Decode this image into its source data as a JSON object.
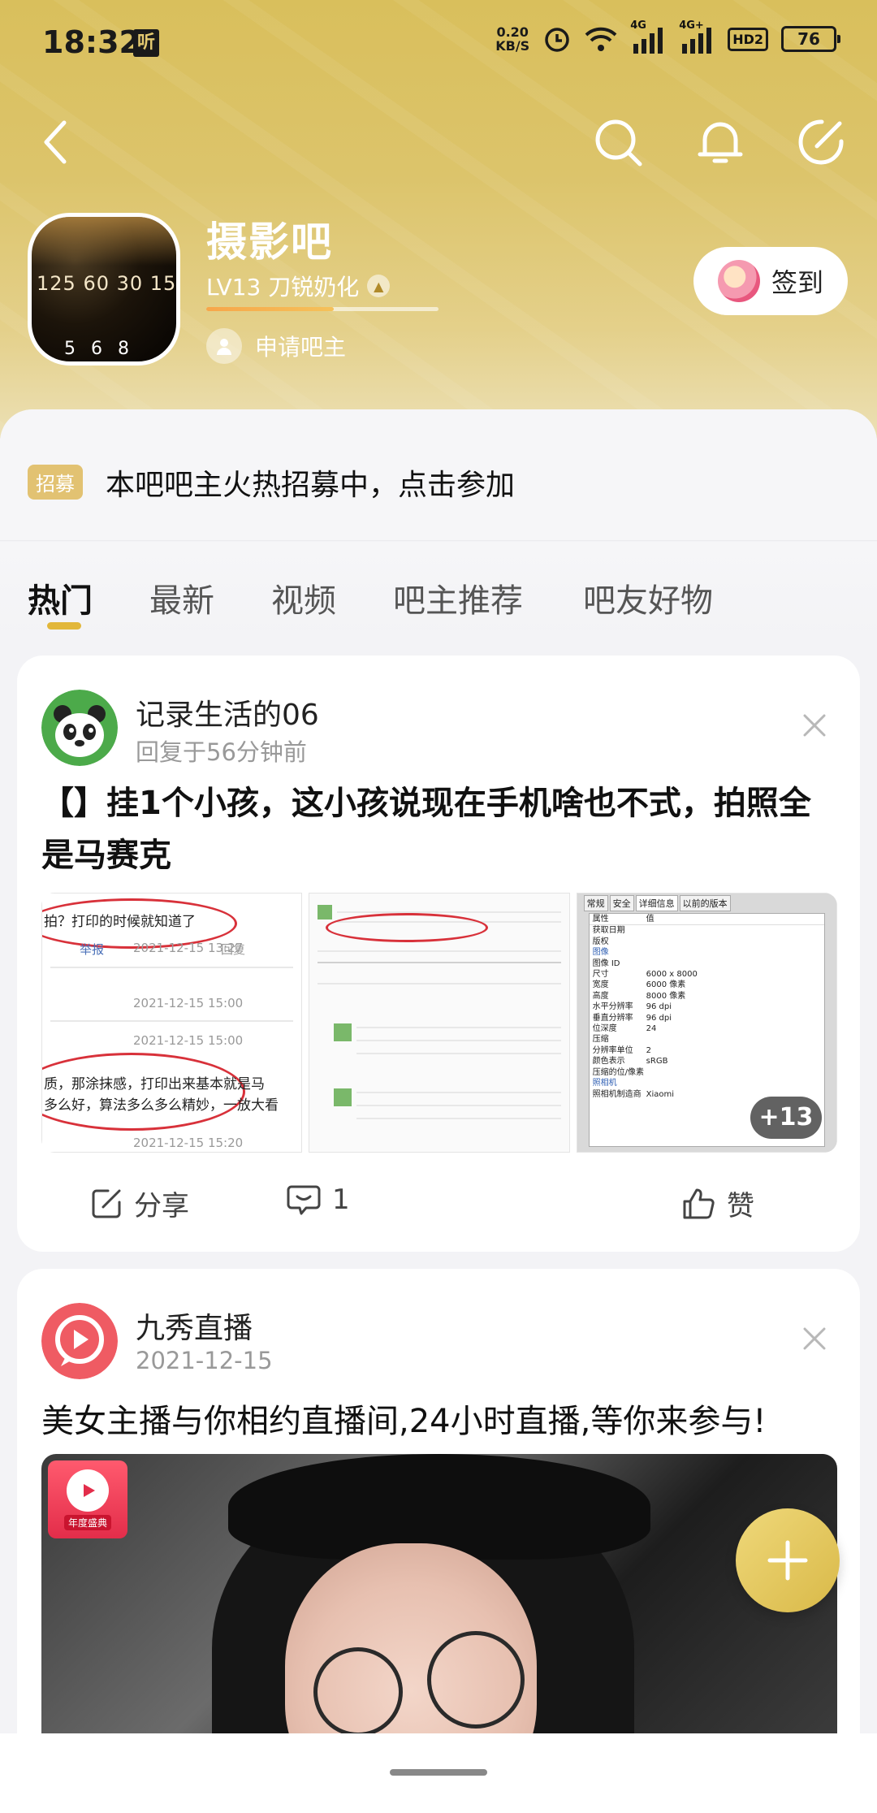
{
  "status_bar": {
    "time": "18:32",
    "notif_badge": "听",
    "net_speed_value": "0.20",
    "net_speed_unit": "KB/S",
    "signal1": "4G",
    "signal2": "4G+",
    "hd": "HD2",
    "battery": "76"
  },
  "forum": {
    "name": "摄影吧",
    "level": "LV13 刀锐奶化",
    "level_progress": 0.55,
    "apply_label": "申请吧主",
    "sign_label": "签到",
    "avatar_lens_text": "125 60 30 15",
    "avatar_lens_bottom": "5 6 8"
  },
  "notice": {
    "tag": "招募",
    "text": "本吧吧主火热招募中，点击参加"
  },
  "tabs": [
    "热门",
    "最新",
    "视频",
    "吧主推荐",
    "吧友好物"
  ],
  "posts": [
    {
      "author": "记录生活的06",
      "time": "回复于56分钟前",
      "title": "【】挂1个小孩，这小孩说现在手机啥也不式，拍照全是马赛克",
      "more_images": "+13",
      "share_label": "分享",
      "comment_count": "1",
      "like_label": "赞",
      "thumb1": {
        "line1": "拍？打印的时候就知道了",
        "report": "举报",
        "date1": "2021-12-15 13:27",
        "reply": "回复",
        "date2": "2021-12-15 15:00",
        "date3": "2021-12-15 15:00",
        "line2": "质，那涂抹感，打印出来基本就是马",
        "line3": "多么好，算法多么多么精妙，一放大看",
        "date4": "2021-12-15 15:20"
      },
      "thumb3": {
        "tabs": [
          "常规",
          "安全",
          "详细信息",
          "以前的版本"
        ],
        "col1": "属性",
        "col2": "值",
        "rows": [
          [
            "获取日期",
            ""
          ],
          [
            "版权",
            ""
          ],
          [
            "图像",
            ""
          ],
          [
            "图像 ID",
            ""
          ],
          [
            "尺寸",
            "6000 x 8000"
          ],
          [
            "宽度",
            "6000 像素"
          ],
          [
            "高度",
            "8000 像素"
          ],
          [
            "水平分辨率",
            "96 dpi"
          ],
          [
            "垂直分辨率",
            "96 dpi"
          ],
          [
            "位深度",
            "24"
          ],
          [
            "压缩",
            ""
          ],
          [
            "分辨率单位",
            "2"
          ],
          [
            "颜色表示",
            "sRGB"
          ],
          [
            "压缩的位/像素",
            ""
          ],
          [
            "照相机",
            ""
          ],
          [
            "照相机制造商",
            "Xiaomi"
          ]
        ]
      }
    },
    {
      "author": "九秀直播",
      "time": "2021-12-15",
      "text": "美女主播与你相约直播间,24小时直播,等你来参与!",
      "ad_logo_label": "年度盛典"
    }
  ],
  "colors": {
    "accent": "#e2b73a",
    "header": "#d9bf5c",
    "tag": "#e2c272"
  }
}
